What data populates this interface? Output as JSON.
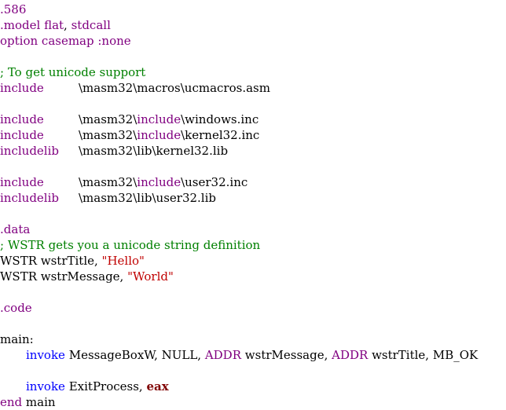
{
  "editor": {
    "lines": [
      [
        {
          "t": ".586",
          "c": "purple"
        }
      ],
      [
        {
          "t": ".model flat",
          "c": "purple"
        },
        {
          "t": ", ",
          "c": "black"
        },
        {
          "t": "stdcall",
          "c": "purple"
        }
      ],
      [
        {
          "t": "option casemap :none",
          "c": "purple"
        }
      ],
      [],
      [
        {
          "t": "; To get unicode support",
          "c": "green"
        }
      ],
      [
        {
          "t": "include",
          "c": "purple",
          "w": "ind1"
        },
        {
          "t": "\\masm32\\macros\\ucmacros.asm",
          "c": "black"
        }
      ],
      [],
      [
        {
          "t": "include",
          "c": "purple",
          "w": "ind1"
        },
        {
          "t": "\\masm32\\",
          "c": "black"
        },
        {
          "t": "include",
          "c": "purple"
        },
        {
          "t": "\\windows.inc",
          "c": "black"
        }
      ],
      [
        {
          "t": "include",
          "c": "purple",
          "w": "ind1"
        },
        {
          "t": "\\masm32\\",
          "c": "black"
        },
        {
          "t": "include",
          "c": "purple"
        },
        {
          "t": "\\kernel32.inc",
          "c": "black"
        }
      ],
      [
        {
          "t": "includelib",
          "c": "purple",
          "w": "ind1"
        },
        {
          "t": "\\masm32\\lib\\kernel32.lib",
          "c": "black"
        }
      ],
      [],
      [
        {
          "t": "include",
          "c": "purple",
          "w": "ind1"
        },
        {
          "t": "\\masm32\\",
          "c": "black"
        },
        {
          "t": "include",
          "c": "purple"
        },
        {
          "t": "\\user32.inc",
          "c": "black"
        }
      ],
      [
        {
          "t": "includelib",
          "c": "purple",
          "w": "ind1"
        },
        {
          "t": "\\masm32\\lib\\user32.lib",
          "c": "black"
        }
      ],
      [],
      [
        {
          "t": ".data",
          "c": "purple"
        }
      ],
      [
        {
          "t": "; WSTR gets you a unicode string definition",
          "c": "green"
        }
      ],
      [
        {
          "t": "WSTR wstrTitle, ",
          "c": "black"
        },
        {
          "t": "\"Hello\"",
          "c": "red"
        }
      ],
      [
        {
          "t": "WSTR wstrMessage, ",
          "c": "black"
        },
        {
          "t": "\"World\"",
          "c": "red"
        }
      ],
      [],
      [
        {
          "t": ".code",
          "c": "purple"
        }
      ],
      [],
      [
        {
          "t": "main:",
          "c": "black"
        }
      ],
      [
        {
          "t": "",
          "c": "black",
          "w": "tabin"
        },
        {
          "t": "invoke",
          "c": "blue"
        },
        {
          "t": " MessageBoxW, NULL, ",
          "c": "black"
        },
        {
          "t": "ADDR",
          "c": "purple"
        },
        {
          "t": " wstrMessage, ",
          "c": "black"
        },
        {
          "t": "ADDR",
          "c": "purple"
        },
        {
          "t": " wstrTitle, MB_OK",
          "c": "black"
        }
      ],
      [],
      [
        {
          "t": "",
          "c": "black",
          "w": "tabin"
        },
        {
          "t": "invoke",
          "c": "blue"
        },
        {
          "t": " ExitProcess, ",
          "c": "black"
        },
        {
          "t": "eax",
          "c": "dark"
        }
      ],
      [
        {
          "t": "end",
          "c": "purple"
        },
        {
          "t": " main",
          "c": "black"
        }
      ]
    ]
  }
}
